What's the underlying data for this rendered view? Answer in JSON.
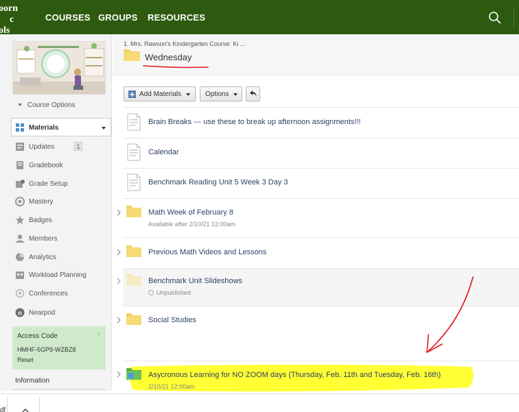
{
  "nav": {
    "logo_lines": [
      "oorn",
      "c",
      "ols"
    ],
    "links": [
      "COURSES",
      "GROUPS",
      "RESOURCES"
    ],
    "search_icon": "search-icon",
    "brand_color": "#2e5a0f"
  },
  "sidebar": {
    "course_options": "Course Options",
    "active_item": "Materials",
    "items": [
      {
        "label": "Updates",
        "icon": "updates-icon",
        "badge": "1"
      },
      {
        "label": "Gradebook",
        "icon": "gradebook-icon"
      },
      {
        "label": "Grade Setup",
        "icon": "grade-setup-icon"
      },
      {
        "label": "Mastery",
        "icon": "mastery-icon"
      },
      {
        "label": "Badges",
        "icon": "badges-icon"
      },
      {
        "label": "Members",
        "icon": "members-icon"
      },
      {
        "label": "Analytics",
        "icon": "analytics-icon"
      },
      {
        "label": "Workload Planning",
        "icon": "workload-icon"
      },
      {
        "label": "Conferences",
        "icon": "conferences-icon"
      },
      {
        "label": "Nearpod",
        "icon": "nearpod-icon"
      }
    ],
    "access_code": {
      "title": "Access Code",
      "code": "HMHF-5GP9-WZBZ8",
      "reset": "Reset",
      "close": "×"
    },
    "information": "Information"
  },
  "header": {
    "breadcrumb": "1. Mrs. Rawson's Kindergarten Course: Ki ...",
    "title": "Wednesday"
  },
  "toolbar": {
    "add_materials": "Add Materials",
    "options": "Options"
  },
  "materials": [
    {
      "type": "page",
      "title": "Brain Breaks --- use these to break up afternoon assignments!!!"
    },
    {
      "type": "page",
      "title": "Calendar"
    },
    {
      "type": "page",
      "title": "Benchmark Reading Unit 5 Week 3 Day 3"
    },
    {
      "type": "folder",
      "title": "Math Week of February 8",
      "sub": "Available after 2/10/21 12:00am"
    },
    {
      "type": "folder",
      "title": "Previous Math Videos and Lessons"
    },
    {
      "type": "folder-unpublished",
      "title": "Benchmark Unit Slideshows",
      "sub": "Unpublished"
    },
    {
      "type": "folder",
      "title": "Social Studies"
    },
    {
      "type": "folder-green",
      "title": "Asycronous Learning for NO ZOOM days (Thursday, Feb. 11th and Tuesday, Feb. 16th)",
      "sub": "2/10/21 12:00am"
    }
  ],
  "downloads": {
    "file": "df"
  },
  "colors": {
    "folder": "#f2d164",
    "link": "#2c3f63",
    "highlight": "#ffff33",
    "annotation": "#e0191f",
    "access_bg": "#cfeacb"
  }
}
